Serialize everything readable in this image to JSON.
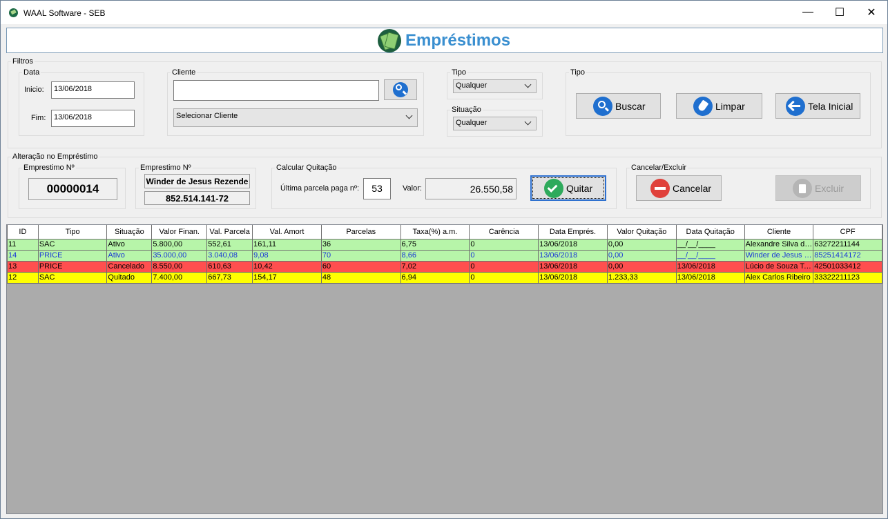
{
  "window": {
    "title": "WAAL Software - SEB",
    "minimize": "—",
    "maximize": "☐",
    "close": "✕"
  },
  "header": {
    "title": "Empréstimos"
  },
  "filters": {
    "legend": "Filtros",
    "data_legend": "Data",
    "inicio_label": "Inicio:",
    "inicio_value": "13/06/2018",
    "fim_label": "Fim:",
    "fim_value": "13/06/2018",
    "cliente_legend": "Cliente",
    "cliente_search_value": "",
    "cliente_select": "Selecionar Cliente",
    "tipo_legend": "Tipo",
    "tipo_value": "Qualquer",
    "situacao_legend": "Situação",
    "situacao_value": "Qualquer",
    "actions_legend": "Tipo",
    "buscar": "Buscar",
    "limpar": "Limpar",
    "tela_inicial": "Tela Inicial"
  },
  "alteracao": {
    "legend": "Alteração no Empréstimo",
    "emprestimo_legend": "Emprestimo Nº",
    "emprestimo_num": "00000014",
    "cliente_legend": "Emprestimo Nº",
    "cliente_nome": "Winder de Jesus Rezende",
    "cliente_cpf": "852.514.141-72",
    "quitacao_legend": "Calcular Quitação",
    "ultima_parcela_label": "Última parcela paga nº:",
    "ultima_parcela_value": "53",
    "valor_label": "Valor:",
    "valor_value": "26.550,58",
    "quitar": "Quitar",
    "cancelar_legend": "Cancelar/Excluir",
    "cancelar": "Cancelar",
    "excluir": "Excluir"
  },
  "grid": {
    "columns": [
      "ID",
      "Tipo",
      "Situação",
      "Valor Finan.",
      "Val. Parcela",
      "Val. Amort",
      "Parcelas",
      "Taxa(%) a.m.",
      "Carência",
      "Data Emprés.",
      "Valor Quitação",
      "Data Quitação",
      "Cliente",
      "CPF"
    ],
    "rows": [
      {
        "cells": [
          "11",
          "SAC",
          "Ativo",
          "5.800,00",
          "552,61",
          "161,11",
          "36",
          "6,75",
          "0",
          "13/06/2018",
          "0,00",
          "__/__/____",
          "Alexandre Silva dos Santos",
          "63272211144"
        ],
        "bg": "#b7f5a9",
        "fg": "#000000"
      },
      {
        "cells": [
          "14",
          "PRICE",
          "Ativo",
          "35.000,00",
          "3.040,08",
          "9,08",
          "70",
          "8,66",
          "0",
          "13/06/2018",
          "0,00",
          "__/__/____",
          "Winder de Jesus Rezende",
          "85251414172"
        ],
        "bg": "#b7f5a9",
        "fg": "#1a37d6"
      },
      {
        "cells": [
          "13",
          "PRICE",
          "Cancelado",
          "8.550,00",
          "610,63",
          "10,42",
          "60",
          "7,02",
          "0",
          "13/06/2018",
          "0,00",
          "13/06/2018",
          "Lúcio de Souza Teixeira",
          "42501033412"
        ],
        "bg": "#ff4f4f",
        "fg": "#000000"
      },
      {
        "cells": [
          "12",
          "SAC",
          "Quitado",
          "7.400,00",
          "667,73",
          "154,17",
          "48",
          "6,94",
          "0",
          "13/06/2018",
          "1.233,33",
          "13/06/2018",
          "Alex Carlos Ribeiro",
          "33322211123"
        ],
        "bg": "#ffff00",
        "fg": "#000000"
      }
    ]
  }
}
